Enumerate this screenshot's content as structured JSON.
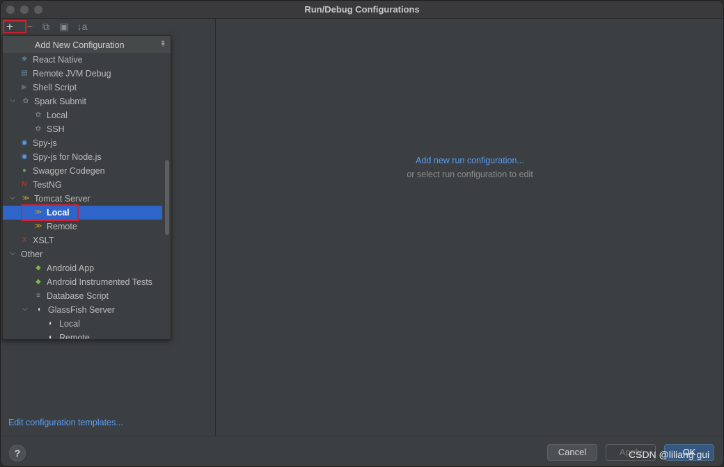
{
  "window": {
    "title": "Run/Debug Configurations"
  },
  "toolbar": {
    "add": "+",
    "remove": "−",
    "copy": "⧉",
    "folder": "▣",
    "sort": "↓a"
  },
  "popup": {
    "title": "Add New Configuration",
    "items": [
      {
        "label": "React Native",
        "icon": "react-icon",
        "color": "#61dafb",
        "level": 1,
        "arrow": ""
      },
      {
        "label": "Remote JVM Debug",
        "icon": "remote-debug-icon",
        "color": "#6a8aa6",
        "level": 1,
        "arrow": ""
      },
      {
        "label": "Shell Script",
        "icon": "shell-icon",
        "color": "#6b6b6b",
        "level": 1,
        "arrow": ""
      },
      {
        "label": "Spark Submit",
        "icon": "spark-icon",
        "color": "#cfcfcf",
        "level": 1,
        "arrow": "down"
      },
      {
        "label": "Local",
        "icon": "spark-icon",
        "color": "#cfcfcf",
        "level": 2,
        "arrow": ""
      },
      {
        "label": "SSH",
        "icon": "spark-icon",
        "color": "#cfcfcf",
        "level": 2,
        "arrow": ""
      },
      {
        "label": "Spy-js",
        "icon": "spy-icon",
        "color": "#5d9cec",
        "level": 1,
        "arrow": ""
      },
      {
        "label": "Spy-js for Node.js",
        "icon": "spy-icon",
        "color": "#5d9cec",
        "level": 1,
        "arrow": ""
      },
      {
        "label": "Swagger Codegen",
        "icon": "swagger-icon",
        "color": "#5fa83b",
        "level": 1,
        "arrow": ""
      },
      {
        "label": "TestNG",
        "icon": "testng-icon",
        "color": "#c33d2d",
        "level": 1,
        "arrow": ""
      },
      {
        "label": "Tomcat Server",
        "icon": "tomcat-icon",
        "color": "#d8a12a",
        "level": 1,
        "arrow": "down"
      },
      {
        "label": "Local",
        "icon": "tomcat-icon",
        "color": "#d8a12a",
        "level": 2,
        "arrow": "",
        "selected": true
      },
      {
        "label": "Remote",
        "icon": "tomcat-icon",
        "color": "#d8a12a",
        "level": 2,
        "arrow": ""
      },
      {
        "label": "XSLT",
        "icon": "xslt-icon",
        "color": "#c33d2d",
        "level": 1,
        "arrow": ""
      },
      {
        "label": "Other",
        "icon": "",
        "color": "",
        "level": 0,
        "arrow": "down"
      },
      {
        "label": "Android App",
        "icon": "android-icon",
        "color": "#7ab547",
        "level": 2,
        "arrow": ""
      },
      {
        "label": "Android Instrumented Tests",
        "icon": "android-icon",
        "color": "#7ab547",
        "level": 2,
        "arrow": ""
      },
      {
        "label": "Database Script",
        "icon": "database-icon",
        "color": "#9a9a9a",
        "level": 2,
        "arrow": ""
      },
      {
        "label": "GlassFish Server",
        "icon": "glassfish-icon",
        "color": "#d8d8d8",
        "level": 2,
        "arrow": "down"
      },
      {
        "label": "Local",
        "icon": "glassfish-icon",
        "color": "#d8d8d8",
        "level": 3,
        "arrow": ""
      },
      {
        "label": "Remote",
        "icon": "glassfish-icon",
        "color": "#d8d8d8",
        "level": 3,
        "arrow": ""
      }
    ]
  },
  "left": {
    "edit_templates": "Edit configuration templates..."
  },
  "right": {
    "add_link": "Add new run configuration...",
    "or_text": "or select run configuration to edit"
  },
  "buttons": {
    "cancel": "Cancel",
    "apply": "Apply",
    "ok": "OK",
    "help": "?"
  },
  "watermark": "CSDN @liliang gui"
}
